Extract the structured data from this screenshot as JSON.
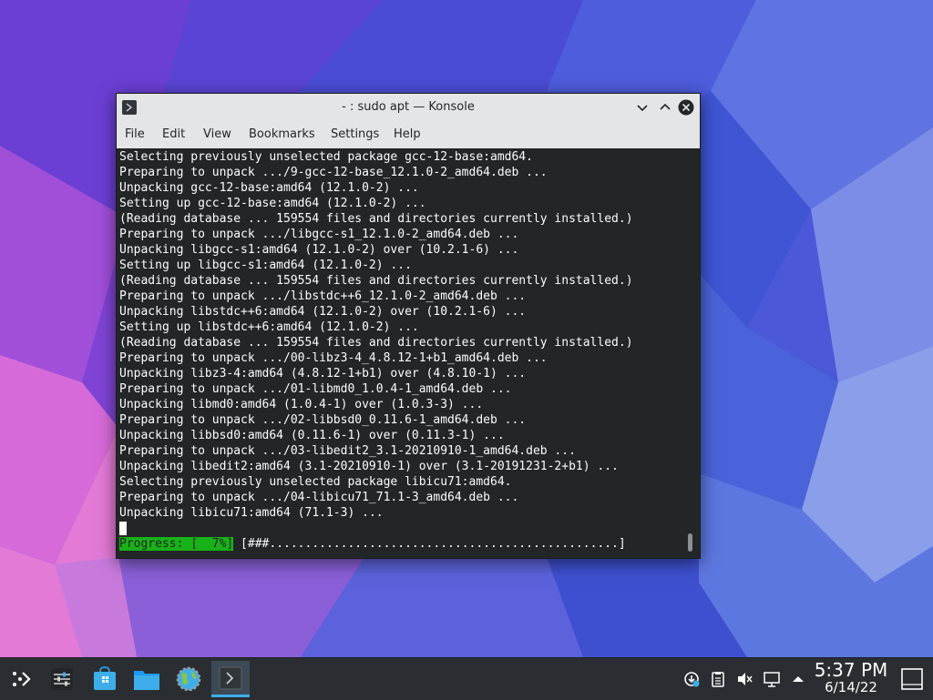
{
  "window": {
    "title": "- : sudo apt — Konsole",
    "menu": [
      "File",
      "Edit",
      "View",
      "Bookmarks",
      "Settings",
      "Help"
    ]
  },
  "terminal": {
    "lines": [
      "Selecting previously unselected package gcc-12-base:amd64.",
      "Preparing to unpack .../9-gcc-12-base_12.1.0-2_amd64.deb ...",
      "Unpacking gcc-12-base:amd64 (12.1.0-2) ...",
      "Setting up gcc-12-base:amd64 (12.1.0-2) ...",
      "(Reading database ... 159554 files and directories currently installed.)",
      "Preparing to unpack .../libgcc-s1_12.1.0-2_amd64.deb ...",
      "Unpacking libgcc-s1:amd64 (12.1.0-2) over (10.2.1-6) ...",
      "Setting up libgcc-s1:amd64 (12.1.0-2) ...",
      "(Reading database ... 159554 files and directories currently installed.)",
      "Preparing to unpack .../libstdc++6_12.1.0-2_amd64.deb ...",
      "Unpacking libstdc++6:amd64 (12.1.0-2) over (10.2.1-6) ...",
      "Setting up libstdc++6:amd64 (12.1.0-2) ...",
      "(Reading database ... 159554 files and directories currently installed.)",
      "Preparing to unpack .../00-libz3-4_4.8.12-1+b1_amd64.deb ...",
      "Unpacking libz3-4:amd64 (4.8.12-1+b1) over (4.8.10-1) ...",
      "Preparing to unpack .../01-libmd0_1.0.4-1_amd64.deb ...",
      "Unpacking libmd0:amd64 (1.0.4-1) over (1.0.3-3) ...",
      "Preparing to unpack .../02-libbsd0_0.11.6-1_amd64.deb ...",
      "Unpacking libbsd0:amd64 (0.11.6-1) over (0.11.3-1) ...",
      "Preparing to unpack .../03-libedit2_3.1-20210910-1_amd64.deb ...",
      "Unpacking libedit2:amd64 (3.1-20210910-1) over (3.1-20191231-2+b1) ...",
      "Selecting previously unselected package libicu71:amd64.",
      "Preparing to unpack .../04-libicu71_71.1-3_amd64.deb ...",
      "Unpacking libicu71:amd64 (71.1-3) ..."
    ],
    "progress_label": "Progress: [  7%]",
    "progress_bar": " [###.................................................]",
    "progress_percent": 7,
    "progress_color": "#18b218",
    "background_color": "#232627"
  },
  "taskbar": {
    "launchers": [
      "application-launcher-icon",
      "system-settings-mixer-icon",
      "discover-store-icon",
      "file-manager-folder-icon",
      "browser-globe-icon",
      "konsole-terminal-icon"
    ],
    "tray": [
      "updates-icon",
      "clipboard-icon",
      "volume-muted-icon",
      "network-icon",
      "expand-tray-arrow-icon"
    ],
    "clock_time": "5:37 PM",
    "clock_date": "6/14/22",
    "accent_color": "#3daee9"
  }
}
